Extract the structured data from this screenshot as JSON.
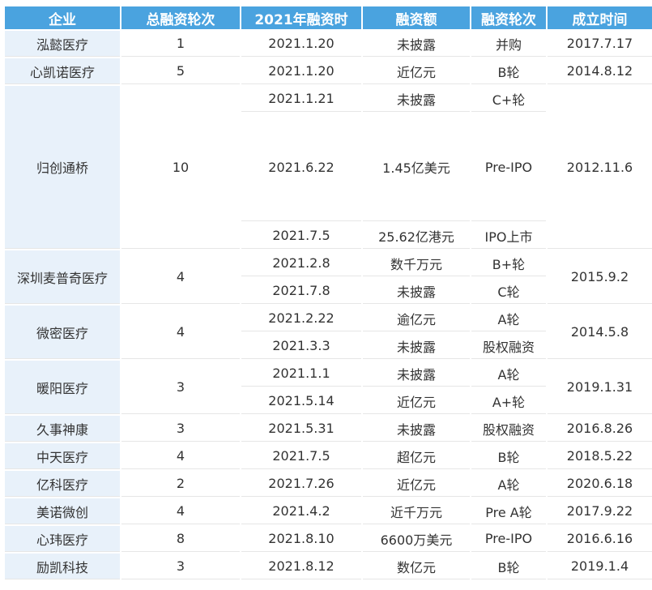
{
  "headers": [
    "企业",
    "总融资轮次",
    "2021年融资时",
    "融资额",
    "融资轮次",
    "成立时间"
  ],
  "companies": [
    {
      "name": "泓懿医疗",
      "rounds_total": "1",
      "founded": "2017.7.17",
      "events": [
        {
          "date": "2021.1.20",
          "amount": "未披露",
          "round": "并购"
        }
      ]
    },
    {
      "name": "心凯诺医疗",
      "rounds_total": "5",
      "founded": "2014.8.12",
      "events": [
        {
          "date": "2021.1.20",
          "amount": "近亿元",
          "round": "B轮"
        }
      ]
    },
    {
      "name": "归创通桥",
      "rounds_total": "10",
      "founded": "2012.11.6",
      "events": [
        {
          "date": "2021.1.21",
          "amount": "未披露",
          "round": "C+轮"
        },
        {
          "date": "2021.6.22",
          "amount": "1.45亿美元",
          "round": "Pre-IPO"
        },
        {
          "date": "2021.7.5",
          "amount": "25.62亿港元",
          "round": "IPO上市"
        }
      ]
    },
    {
      "name": "深圳麦普奇医疗",
      "rounds_total": "4",
      "founded": "2015.9.2",
      "events": [
        {
          "date": "2021.2.8",
          "amount": "数千万元",
          "round": "B+轮"
        },
        {
          "date": "2021.7.8",
          "amount": "未披露",
          "round": "C轮"
        }
      ]
    },
    {
      "name": "微密医疗",
      "rounds_total": "4",
      "founded": "2014.5.8",
      "events": [
        {
          "date": "2021.2.22",
          "amount": "逾亿元",
          "round": "A轮"
        },
        {
          "date": "2021.3.3",
          "amount": "未披露",
          "round": "股权融资"
        }
      ]
    },
    {
      "name": "暖阳医疗",
      "rounds_total": "3",
      "founded": "2019.1.31",
      "events": [
        {
          "date": "2021.1.1",
          "amount": "未披露",
          "round": "A轮"
        },
        {
          "date": "2021.5.14",
          "amount": "近亿元",
          "round": "A+轮"
        }
      ]
    },
    {
      "name": "久事神康",
      "rounds_total": "3",
      "founded": "2016.8.26",
      "events": [
        {
          "date": "2021.5.31",
          "amount": "未披露",
          "round": "股权融资"
        }
      ]
    },
    {
      "name": "中天医疗",
      "rounds_total": "4",
      "founded": "2018.5.22",
      "events": [
        {
          "date": "2021.7.5",
          "amount": "超亿元",
          "round": "B轮"
        }
      ]
    },
    {
      "name": "亿科医疗",
      "rounds_total": "2",
      "founded": "2020.6.18",
      "events": [
        {
          "date": "2021.7.26",
          "amount": "近亿元",
          "round": "A轮"
        }
      ]
    },
    {
      "name": "美诺微创",
      "rounds_total": "4",
      "founded": "2017.9.22",
      "events": [
        {
          "date": "2021.4.2",
          "amount": "近千万元",
          "round": "Pre A轮"
        }
      ]
    },
    {
      "name": "心玮医疗",
      "rounds_total": "8",
      "founded": "2016.6.16",
      "events": [
        {
          "date": "2021.8.10",
          "amount": "6600万美元",
          "round": "Pre-IPO"
        }
      ]
    },
    {
      "name": "励凯科技",
      "rounds_total": "3",
      "founded": "2019.1.4",
      "events": [
        {
          "date": "2021.8.12",
          "amount": "数亿元",
          "round": "B轮"
        }
      ]
    }
  ],
  "colors": {
    "header_bg": "#4aa3df",
    "header_text": "#ffffff",
    "company_cell_bg": "#e8f1fa",
    "body_text": "#333333"
  }
}
